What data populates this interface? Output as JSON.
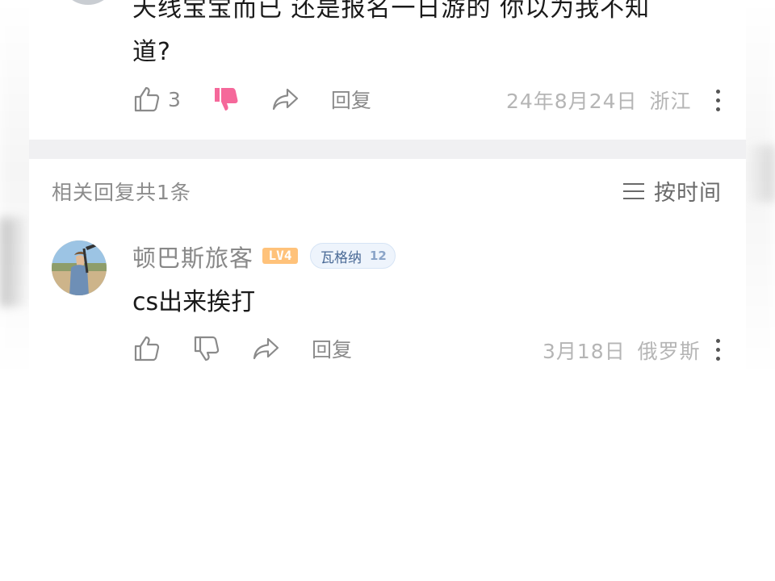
{
  "top_comment": {
    "text_line1": "天线宝宝而已  还是报名一日游的  你以为我不知",
    "text_line2": "道?",
    "like_count": "3",
    "reply_label": "回复",
    "date": "24年8月24日",
    "location": "浙江",
    "dislike_active_color": "#f5689a"
  },
  "related": {
    "title": "相关回复共1条",
    "sort_label": "按时间"
  },
  "reply": {
    "username": "顿巴斯旅客",
    "level_badge": "LV4",
    "medal_name": "瓦格纳",
    "medal_level": "12",
    "text": "cs出来挨打",
    "reply_label": "回复",
    "date": "3月18日",
    "location": "俄罗斯"
  }
}
